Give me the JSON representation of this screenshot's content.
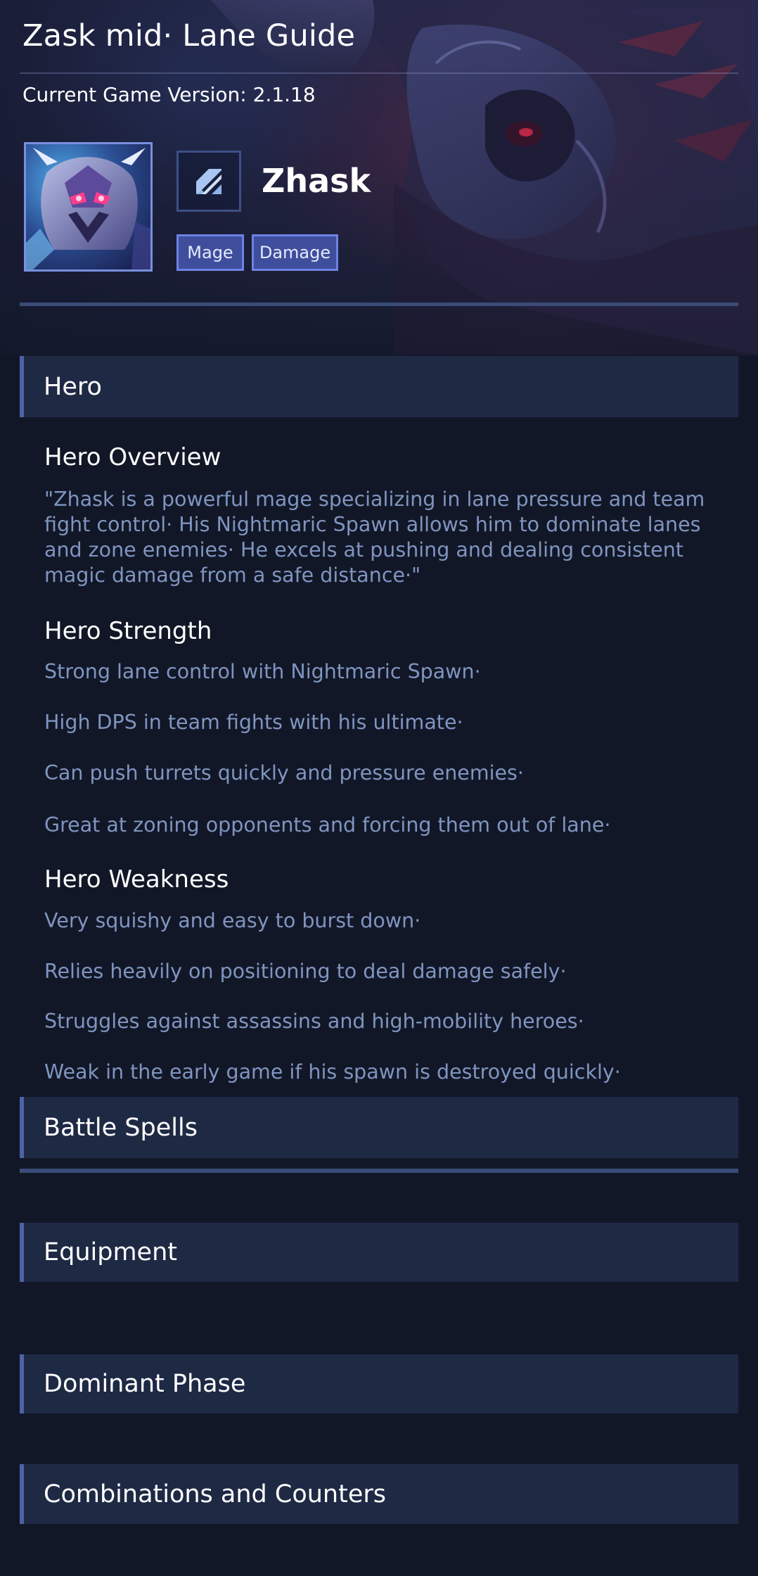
{
  "page_title": "Zask mid· Lane Guide",
  "game_version": "Current Game Version: 2.1.18",
  "hero": {
    "name": "Zhask",
    "portrait_icon": "hero-portrait",
    "emblem_icon": "mage-class-icon",
    "roles": [
      "Mage",
      "Damage"
    ]
  },
  "sections": {
    "hero": {
      "label": "Hero",
      "overview_title": "Hero Overview",
      "overview_text": "\"Zhask is a powerful mage specializing in lane pressure and team fight control· His Nightmaric Spawn allows him to dominate lanes and zone enemies· He excels at pushing and dealing consistent magic damage from a safe distance·\"",
      "strength_title": "Hero Strength",
      "strengths": [
        "Strong lane control with Nightmaric Spawn·",
        "High DPS in team fights with his ultimate·",
        "Can push turrets quickly and pressure enemies·",
        "Great at zoning opponents and forcing them out of lane·"
      ],
      "weakness_title": "Hero Weakness",
      "weaknesses": [
        "Very squishy and easy to burst down·",
        "Relies heavily on positioning to deal damage safely·",
        "Struggles against assassins and high-mobility heroes·",
        "Weak in the early game if his spawn is destroyed quickly·"
      ]
    },
    "battle_spells": {
      "label": "Battle Spells"
    },
    "equipment": {
      "label": "Equipment"
    },
    "dominant_phase": {
      "label": "Dominant Phase"
    },
    "combos": {
      "label": "Combinations and Counters"
    }
  },
  "colors": {
    "background": "#121727",
    "section_header_bg": "#1e2944",
    "accent": "#4d63a6",
    "body_text": "#7f95c0",
    "role_tag_bg": "#3f4e9c"
  }
}
